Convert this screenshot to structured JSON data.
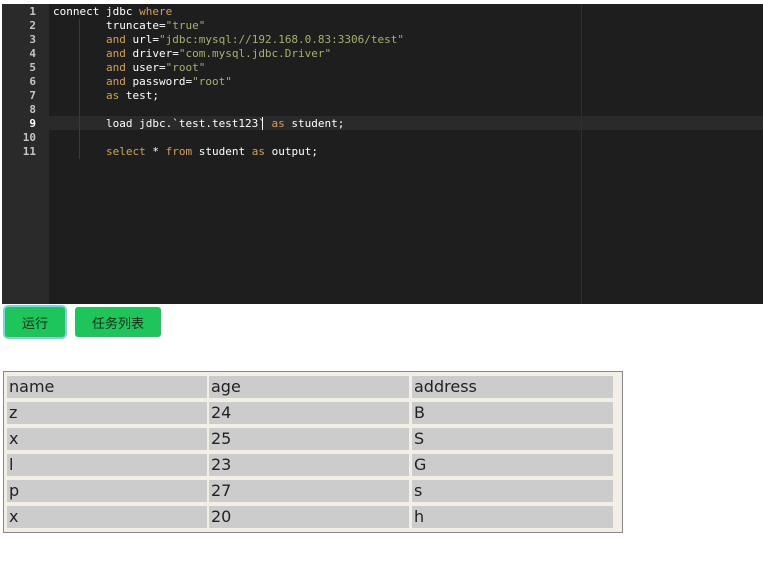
{
  "editor": {
    "line_numbers": [
      "1",
      "2",
      "3",
      "4",
      "5",
      "6",
      "7",
      "8",
      "9",
      "10",
      "11"
    ],
    "lines": [
      [
        {
          "t": "connect ",
          "c": "id"
        },
        {
          "t": "jdbc ",
          "c": "id"
        },
        {
          "t": "where",
          "c": "kw"
        }
      ],
      [
        {
          "t": "        truncate",
          "c": "id"
        },
        {
          "t": "=",
          "c": "id"
        },
        {
          "t": "\"true\"",
          "c": "str"
        }
      ],
      [
        {
          "t": "        ",
          "c": "id"
        },
        {
          "t": "and",
          "c": "kw"
        },
        {
          "t": " url",
          "c": "id"
        },
        {
          "t": "=",
          "c": "id"
        },
        {
          "t": "\"jdbc:mysql://192.168.0.83:3306/test\"",
          "c": "str"
        }
      ],
      [
        {
          "t": "        ",
          "c": "id"
        },
        {
          "t": "and",
          "c": "kw"
        },
        {
          "t": " driver",
          "c": "id"
        },
        {
          "t": "=",
          "c": "id"
        },
        {
          "t": "\"com.mysql.jdbc.Driver\"",
          "c": "str"
        }
      ],
      [
        {
          "t": "        ",
          "c": "id"
        },
        {
          "t": "and",
          "c": "kw"
        },
        {
          "t": " user",
          "c": "id"
        },
        {
          "t": "=",
          "c": "id"
        },
        {
          "t": "\"root\"",
          "c": "str"
        }
      ],
      [
        {
          "t": "        ",
          "c": "id"
        },
        {
          "t": "and",
          "c": "kw"
        },
        {
          "t": " password",
          "c": "id"
        },
        {
          "t": "=",
          "c": "id"
        },
        {
          "t": "\"root\"",
          "c": "str"
        }
      ],
      [
        {
          "t": "        ",
          "c": "id"
        },
        {
          "t": "as",
          "c": "kw"
        },
        {
          "t": " test;",
          "c": "id"
        }
      ],
      [],
      [
        {
          "t": "        load jdbc.`test.test123` ",
          "c": "id"
        },
        {
          "t": "as",
          "c": "kw"
        },
        {
          "t": " student;",
          "c": "id"
        }
      ],
      [],
      [
        {
          "t": "        ",
          "c": "id"
        },
        {
          "t": "select",
          "c": "kw"
        },
        {
          "t": " * ",
          "c": "id"
        },
        {
          "t": "from",
          "c": "kw"
        },
        {
          "t": " student ",
          "c": "id"
        },
        {
          "t": "as",
          "c": "kw"
        },
        {
          "t": " output;",
          "c": "id"
        }
      ]
    ],
    "active_line": 9
  },
  "toolbar": {
    "run_label": "运行",
    "tasks_label": "任务列表"
  },
  "table": {
    "headers": [
      "name",
      "age",
      "address"
    ],
    "rows": [
      [
        "z",
        "24",
        "B"
      ],
      [
        "x",
        "25",
        "S"
      ],
      [
        "l",
        "23",
        "G"
      ],
      [
        "p",
        "27",
        "s"
      ],
      [
        "x",
        "20",
        "h"
      ]
    ]
  },
  "colors": {
    "button_green": "#1ec55a",
    "editor_bg": "#1e1e1e",
    "keyword": "#d4a14b",
    "string": "#a8b06a"
  }
}
